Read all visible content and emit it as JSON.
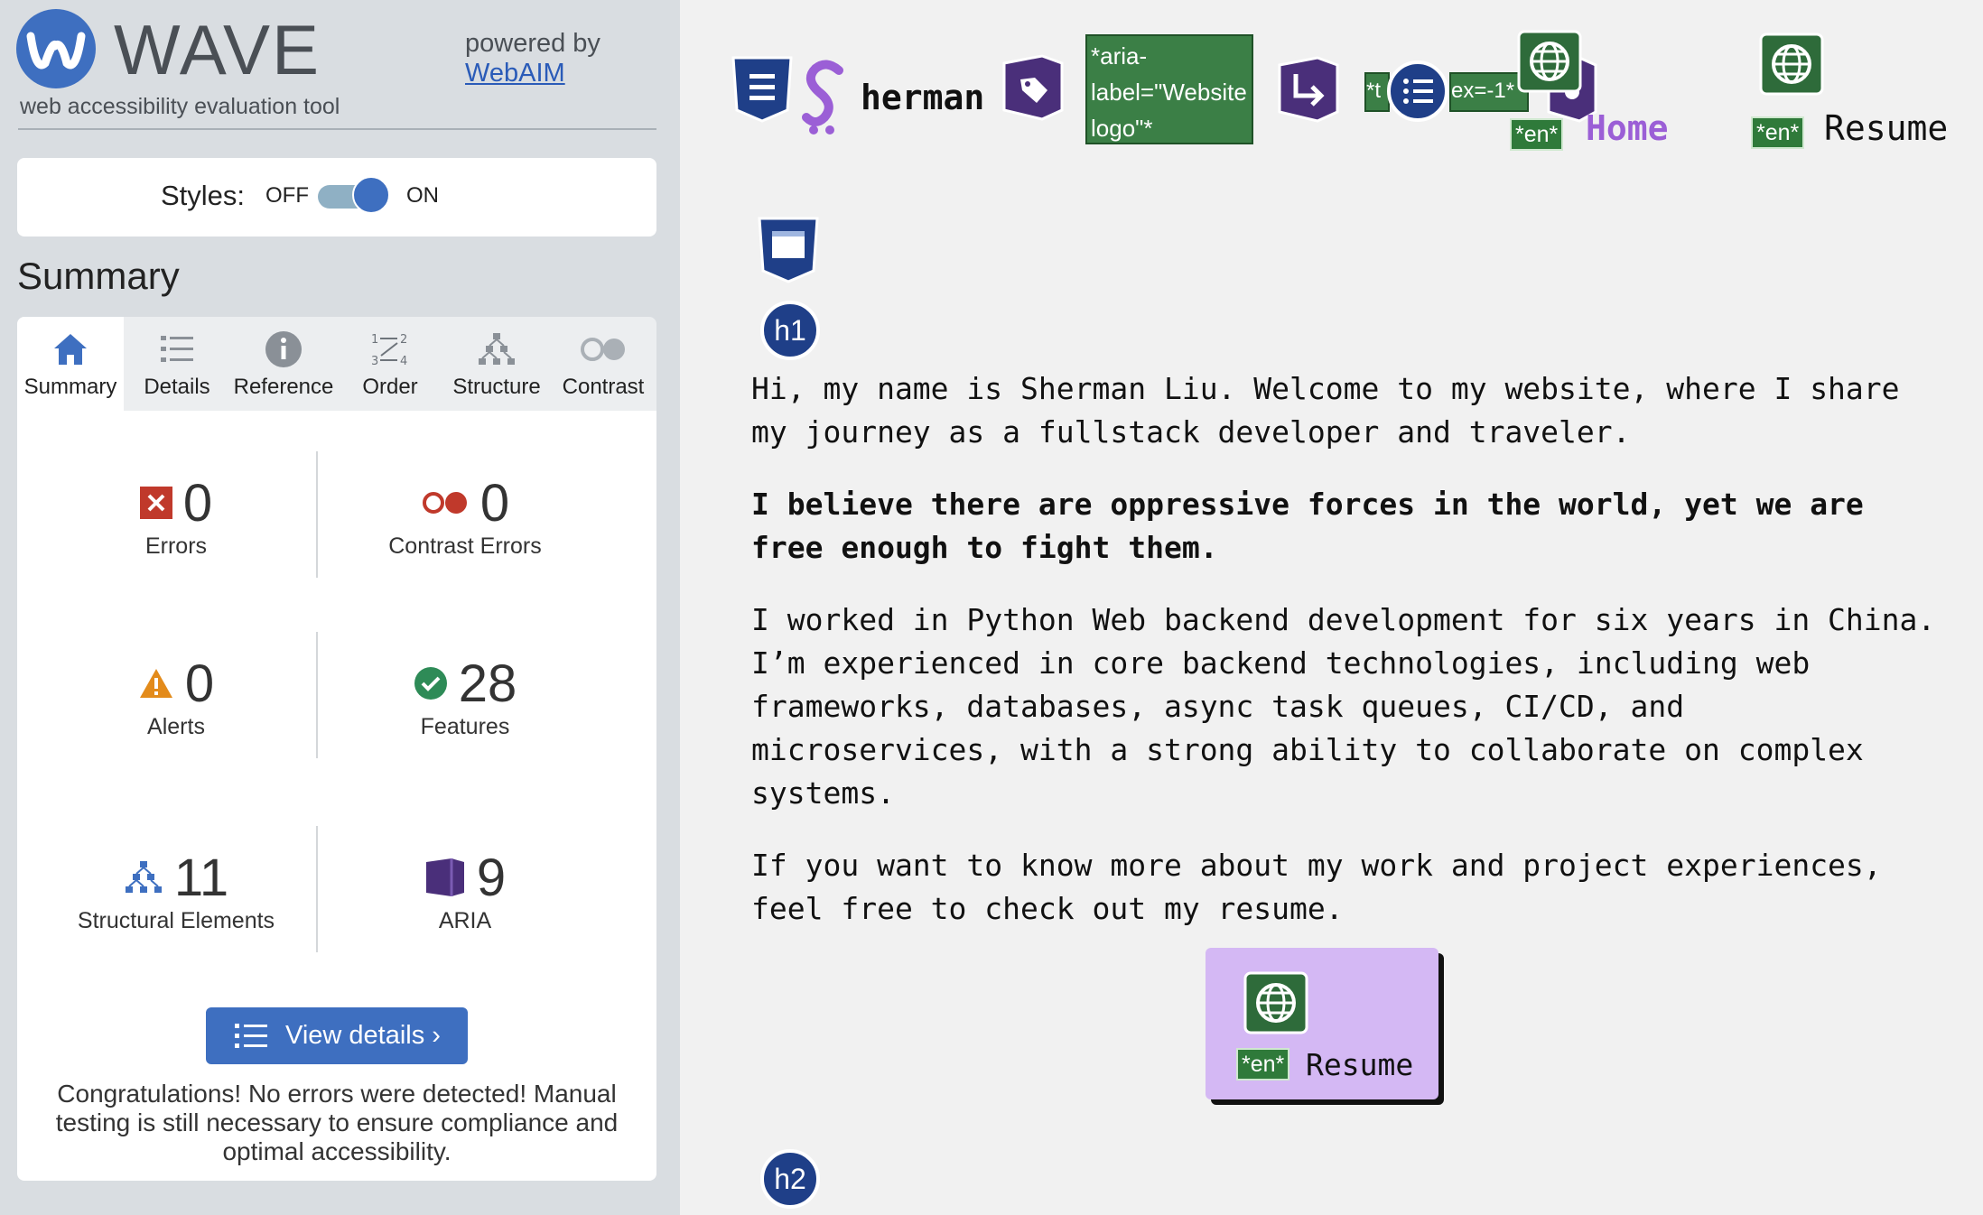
{
  "wave": {
    "logo_text": "WAVE",
    "tagline": "web accessibility evaluation tool",
    "powered_by": "powered by",
    "webaim_link": "WebAIM",
    "styles": {
      "label": "Styles:",
      "off": "OFF",
      "on": "ON",
      "state": "on"
    },
    "summary_heading": "Summary",
    "tabs": [
      {
        "label": "Summary",
        "icon": "home-icon",
        "active": true
      },
      {
        "label": "Details",
        "icon": "list-icon"
      },
      {
        "label": "Reference",
        "icon": "info-icon"
      },
      {
        "label": "Order",
        "icon": "order-icon"
      },
      {
        "label": "Structure",
        "icon": "structure-icon"
      },
      {
        "label": "Contrast",
        "icon": "contrast-icon"
      }
    ],
    "stats": {
      "errors": {
        "count": "0",
        "label": "Errors"
      },
      "contrast_errors": {
        "count": "0",
        "label": "Contrast Errors"
      },
      "alerts": {
        "count": "0",
        "label": "Alerts"
      },
      "features": {
        "count": "28",
        "label": "Features"
      },
      "structural": {
        "count": "11",
        "label": "Structural Elements"
      },
      "aria": {
        "count": "9",
        "label": "ARIA"
      }
    },
    "view_details": "View details ›",
    "congrats": "Congratulations! No errors were detected! Manual testing is still necessary to ensure compliance and optimal accessibility.",
    "colors": {
      "accent": "#3e6fc0",
      "error": "#c0392b",
      "alert": "#e67e22",
      "feature": "#2e8b57",
      "aria": "#4a2f7a",
      "sidebar_bg": "#d9dde1"
    }
  },
  "page": {
    "nav": {
      "brand": "herman",
      "aria_label_box": "*aria-label=\"Website logo\"*",
      "tabindex_box_left": "*t",
      "tabindex_box_right": "ex=-1*",
      "home": "Home",
      "resume": "Resume",
      "lang_tag": "*en*"
    },
    "h1_badge": "h1",
    "h2_badge": "h2",
    "paragraphs": [
      "Hi, my name is Sherman Liu. Welcome to my website, where I share my journey as a fullstack developer and traveler.",
      "I believe there are oppressive forces in the world, yet we are free enough to fight them.",
      "I worked in Python Web backend development for six years in China. I’m experienced in core backend technologies, including web frameworks, databases, async task queues, CI/CD, and microservices, with a strong ability to collaborate on complex systems.",
      "If you want to know more about my work and project experiences, feel free to check out my resume."
    ],
    "resume_button": {
      "lang_tag": "*en*",
      "label": "Resume"
    }
  }
}
